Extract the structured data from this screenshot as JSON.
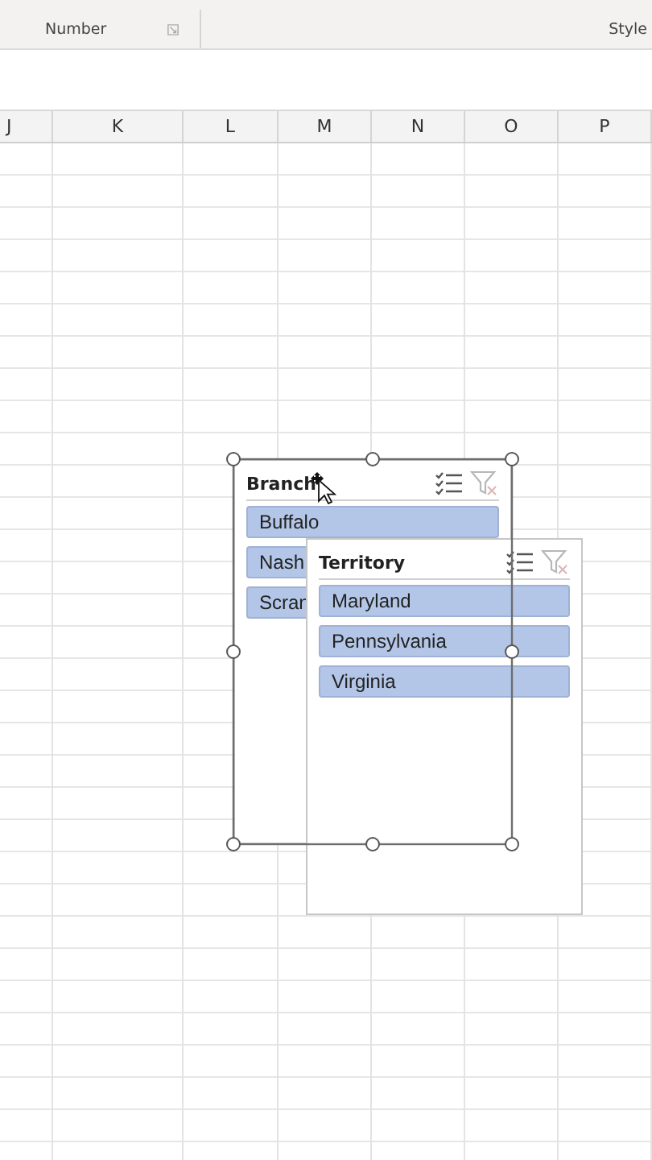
{
  "ribbon": {
    "groups": [
      {
        "label": "Number",
        "launcher": true
      },
      {
        "label": "Style",
        "launcher": false
      }
    ]
  },
  "columns": [
    "J",
    "K",
    "L",
    "M",
    "N",
    "O",
    "P"
  ],
  "slicers": [
    {
      "title": "Branch",
      "selected_frame": true,
      "items": [
        {
          "label": "Buffalo",
          "selected": true
        },
        {
          "label": "Nash",
          "selected": true
        },
        {
          "label": "Scran",
          "selected": true
        }
      ]
    },
    {
      "title": "Territory",
      "selected_frame": false,
      "items": [
        {
          "label": "Maryland",
          "selected": true
        },
        {
          "label": "Pennsylvania",
          "selected": true
        },
        {
          "label": "Virginia",
          "selected": true
        }
      ]
    }
  ]
}
